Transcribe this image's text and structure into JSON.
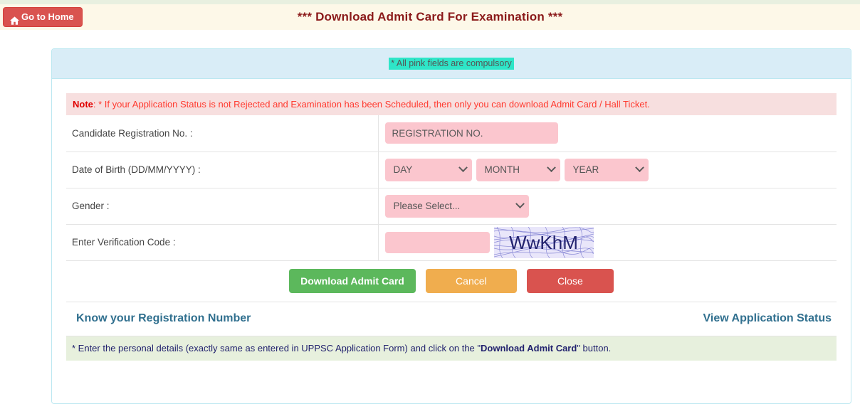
{
  "header": {
    "title": "*** Download Admit Card For Examination ***",
    "home_button_label": "Go to Home"
  },
  "panel": {
    "compulsory_note": "* All pink fields are compulsory",
    "note": {
      "prefix": "Note",
      "text": ": * If your Application Status is not Rejected and Examination has been Scheduled, then only you can download Admit Card / Hall Ticket."
    }
  },
  "form": {
    "rows": [
      {
        "label": "Candidate Registration No. :"
      },
      {
        "label": "Date of Birth (DD/MM/YYYY) :"
      },
      {
        "label": "Gender :"
      },
      {
        "label": "Enter Verification Code :"
      }
    ],
    "registration_placeholder": "REGISTRATION NO.",
    "registration_value": "",
    "dob_day": "DAY",
    "dob_month": "MONTH",
    "dob_year": "YEAR",
    "gender_selected": "Please Select...",
    "captcha_value": "",
    "captcha_text": "WwKhM"
  },
  "buttons": {
    "download": "Download Admit Card",
    "cancel": "Cancel",
    "close": "Close"
  },
  "links": {
    "know_registration": "Know your Registration Number",
    "view_status": "View Application Status"
  },
  "footer": {
    "prefix": "* Enter the personal details (exactly same as entered in UPPSC Application Form) and click on the \"",
    "bold": "Download Admit Card",
    "suffix": " \" button."
  },
  "colors": {
    "header_bg": "#fdf8e8",
    "title": "#8b1a1a",
    "panel_heading_bg": "#d9edf7",
    "highlight": "#2ee6c8",
    "note_bg": "#f7dfdf",
    "note_text": "#ff3b30",
    "pink_field": "#fbc6ce",
    "btn_download": "#5cb85c",
    "btn_cancel": "#f0ad4e",
    "btn_close": "#d9534f",
    "link": "#31708f",
    "footer_bg": "#e7f0dd",
    "footer_text": "#22226e"
  }
}
